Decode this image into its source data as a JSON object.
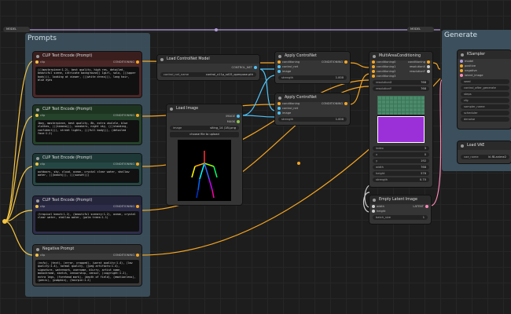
{
  "top_wire": {
    "left_label": "MODEL",
    "right_label": "MODEL"
  },
  "groups": {
    "prompts": "Prompts",
    "generate": "Generate"
  },
  "clip_nodes": [
    {
      "title": "CLIP Text Encode (Prompt)",
      "in": "clip",
      "out": "CONDITIONING",
      "text": "(((masterpiece:1.2), best quality, high res, detailed, beautiful scene, intricate background))\n1girl, solo, (((upper body))), looking at viewer, (((white dress))), long hair, blue eyes"
    },
    {
      "title": "CLIP Text Encode (Prompt)",
      "in": "clip",
      "out": "CONDITIONING",
      "text": "1boy, masterpiece, best quality, 8k, extra ukulele, blue clothes, (((kimono))), sneakers, night sky, (((standing, confident))), street lights, (((full body))), (detailed face:1.2)"
    },
    {
      "title": "CLIP Text Encode (Prompt)",
      "in": "clip",
      "out": "CONDITIONING",
      "text": "outdoors, sky, cloud, ocean, crystal clear water, shallow water, (((beach))), (((sunset)))"
    },
    {
      "title": "CLIP Text Encode (Prompt)",
      "in": "clip",
      "out": "CONDITIONING",
      "text": "(tropical beach:1.2), (beautiful scenery:1.2), ocean, crystal clear water, shallow water, (palm trees:1.1)"
    },
    {
      "title": "Negative Prompt",
      "in": "clip",
      "out": "CONDITIONING",
      "text": "(nsfw), (text), (error, cropped), (worst quality:1.4), (low quality:1.4), normal quality, (jpeg artifacts:1.4), signature, watermark, username, blurry, artist name, monochrome, sketch, censorship, censor, (copyright:1.2), extra legs, (forehead mark), (depth of field), (emotionless), (penis), (pumpkin), (hairpin:1.2)"
    }
  ],
  "controlnet_loader": {
    "title": "Load ControlNet Model",
    "out": "CONTROL_NET",
    "widget_label": "control_net_name",
    "widget_value": "control_v11p_sd15_openpose.pth"
  },
  "load_image": {
    "title": "Load Image",
    "out1": "IMAGE",
    "out2": "MASK",
    "widget_label": "image",
    "widget_value": "siting_14 (18).png",
    "upload_label": "choose file to upload"
  },
  "apply_cn_1": {
    "title": "Apply ControlNet",
    "in1": "conditioning",
    "in2": "control_net",
    "in3": "image",
    "out": "CONDITIONING",
    "widget_label": "strength",
    "widget_value": "1.000"
  },
  "apply_cn_2": {
    "title": "Apply ControlNet",
    "in1": "conditioning",
    "in2": "control_net",
    "in3": "image",
    "out": "CONDITIONING",
    "widget_label": "strength",
    "widget_value": "1.000"
  },
  "multi_area": {
    "title": "MultiAreaConditioning",
    "inputs": [
      "conditioning0",
      "conditioning1",
      "conditioning2",
      "conditioning3"
    ],
    "outputs": [
      "conditioning",
      "resolutionX",
      "resolutionY"
    ],
    "res": [
      {
        "label": "resolutionX",
        "value": "768"
      },
      {
        "label": "resolutionY",
        "value": "768"
      }
    ],
    "widgets": [
      {
        "label": "index",
        "value": "3"
      },
      {
        "label": "x",
        "value": "0"
      },
      {
        "label": "y",
        "value": "192"
      },
      {
        "label": "width",
        "value": "768"
      },
      {
        "label": "height",
        "value": "576"
      },
      {
        "label": "strength",
        "value": "0.70"
      }
    ]
  },
  "latent": {
    "title": "Empty Latent Image",
    "in1": "width",
    "in2": "height",
    "out": "LATENT",
    "widget_label": "batch_size",
    "widget_value": "1"
  },
  "ksampler": {
    "title": "KSampler",
    "inputs": [
      "model",
      "positive",
      "negative",
      "latent_image"
    ],
    "widgets": [
      "seed",
      "control_after_generate",
      "steps",
      "cfg",
      "sampler_name",
      "scheduler",
      "denoise"
    ]
  },
  "lora": {
    "title": "Load VAE",
    "widget_label": "vae_name",
    "widget_value": "kl-f8-anime2"
  },
  "colors": {
    "accent": "#a2c8e1",
    "red_node": "#4a2626",
    "green_node": "#25422a",
    "teal_node": "#254744",
    "blue_node": "#2d2d4a",
    "negative_node": "#3a3a3a"
  }
}
